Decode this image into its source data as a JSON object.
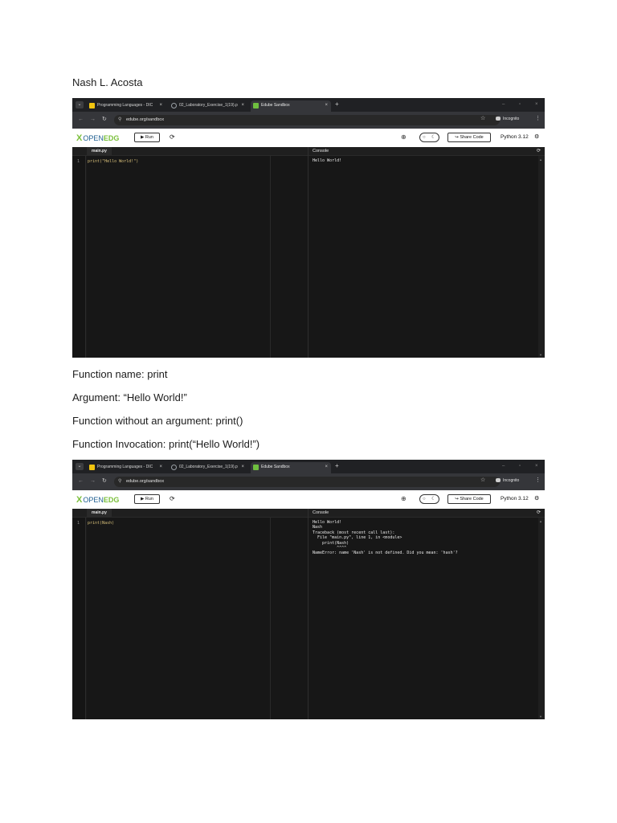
{
  "document": {
    "author": "Nash L. Acosta",
    "lines": [
      "Function name: print",
      "Argument: “Hello World!”",
      "Function without an argument: print()",
      "Function Invocation: print(“Hello World!”)"
    ]
  },
  "screenshots": [
    {
      "browser": {
        "tabs": [
          {
            "label": "Programming Languages - DIC",
            "close": "×"
          },
          {
            "label": "02_Laboratory_Exercise_1(19).p",
            "close": "×"
          },
          {
            "label": "Edube Sandbox",
            "close": "×"
          }
        ],
        "new_tab": "+",
        "url": "edube.org/sandbox",
        "incognito_label": "Incognito"
      },
      "toolbar": {
        "logo_x": "X",
        "logo_open": "OPEN",
        "logo_edg": "EDG",
        "run_label": "▶ Run",
        "share_label": "↪ Share Code",
        "python_version": "Python 3.12"
      },
      "editor": {
        "file_name": "main.py",
        "line_number": "1",
        "code": "print(\"Hello World!\")"
      },
      "console": {
        "title": "Console",
        "output": "Hello World!"
      }
    },
    {
      "browser": {
        "tabs": [
          {
            "label": "Programming Languages - DIC",
            "close": "×"
          },
          {
            "label": "02_Laboratory_Exercise_1(19).p",
            "close": "×"
          },
          {
            "label": "Edube Sandbox",
            "close": "×"
          }
        ],
        "new_tab": "+",
        "url": "edube.org/sandbox",
        "incognito_label": "Incognito"
      },
      "toolbar": {
        "logo_x": "X",
        "logo_open": "OPEN",
        "logo_edg": "EDG",
        "run_label": "▶ Run",
        "share_label": "↪ Share Code",
        "python_version": "Python 3.12"
      },
      "editor": {
        "file_name": "main.py",
        "line_number": "1",
        "code": "print(Nash)"
      },
      "console": {
        "title": "Console",
        "output": "Hello World!\nNash\nTraceback (most recent call last):\n  File \"main.py\", line 1, in <module>\n    print(Nash)\n          ^^^^\nNameError: name 'Nash' is not defined. Did you mean: 'hash'?"
      }
    }
  ]
}
